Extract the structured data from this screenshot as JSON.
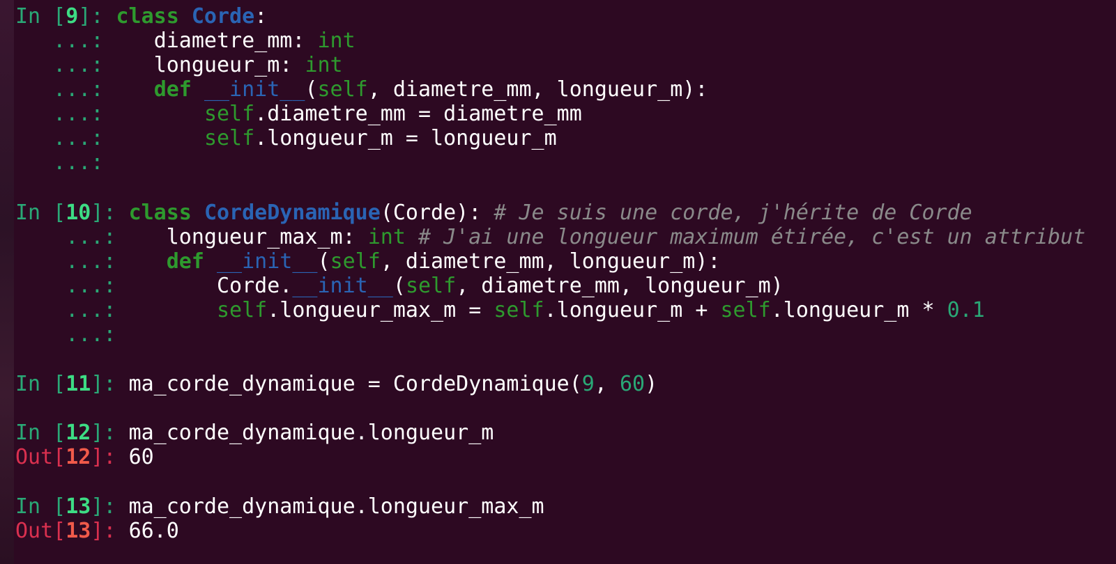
{
  "cells": {
    "c9": {
      "prompt": "In [",
      "num": "9",
      "close": "]: ",
      "l1": {
        "kw": "class",
        "name": "Corde",
        "colon": ":"
      },
      "l2": {
        "cont": "...:",
        "a": "diametre_mm: ",
        "t": "int"
      },
      "l3": {
        "cont": "...:",
        "a": "longueur_m: ",
        "t": "int"
      },
      "l4": {
        "cont": "...:",
        "kw": "def",
        "d": "__init__",
        "p1": "(",
        "self": "self",
        "p2": ", diametre_mm, longueur_m):"
      },
      "l5": {
        "cont": "...:",
        "self": "self",
        "a": ".diametre_mm = diametre_mm"
      },
      "l6": {
        "cont": "...:",
        "self": "self",
        "a": ".longueur_m = longueur_m"
      },
      "l7": {
        "cont": "...:"
      }
    },
    "c10": {
      "prompt": "In [",
      "num": "10",
      "close": "]: ",
      "l1": {
        "kw": "class",
        "name": "CordeDynamique",
        "a": "(Corde): ",
        "cmt": "# Je suis une corde, j'hérite de Corde"
      },
      "l2": {
        "cont": "...:",
        "a": "longueur_max_m: ",
        "t": "int",
        "cmt": " # J'ai une longueur maximum étirée, c'est un attribut"
      },
      "l3": {
        "cont": "...:",
        "kw": "def",
        "d": "__init__",
        "p1": "(",
        "self": "self",
        "p2": ", diametre_mm, longueur_m):"
      },
      "l4": {
        "cont": "...:",
        "a": "Corde.",
        "d": "__init__",
        "p1": "(",
        "self": "self",
        "p2": ", diametre_mm, longueur_m)"
      },
      "l5": {
        "cont": "...:",
        "self1": "self",
        "a1": ".longueur_max_m = ",
        "self2": "self",
        "a2": ".longueur_m + ",
        "self3": "self",
        "a3": ".longueur_m * ",
        "n": "0.1"
      },
      "l6": {
        "cont": "...:"
      }
    },
    "c11": {
      "prompt": "In [",
      "num": "11",
      "close": "]: ",
      "a": "ma_corde_dynamique = CordeDynamique(",
      "n1": "9",
      "sep": ", ",
      "n2": "60",
      "end": ")"
    },
    "c12": {
      "prompt": "In [",
      "num": "12",
      "close": "]: ",
      "a": "ma_corde_dynamique.longueur_m",
      "out_prompt": "Out[",
      "out_num": "12",
      "out_close": "]: ",
      "out_val": "60"
    },
    "c13": {
      "prompt": "In [",
      "num": "13",
      "close": "]: ",
      "a": "ma_corde_dynamique.longueur_max_m",
      "out_prompt": "Out[",
      "out_num": "13",
      "out_close": "]: ",
      "out_val": "66.0"
    }
  }
}
